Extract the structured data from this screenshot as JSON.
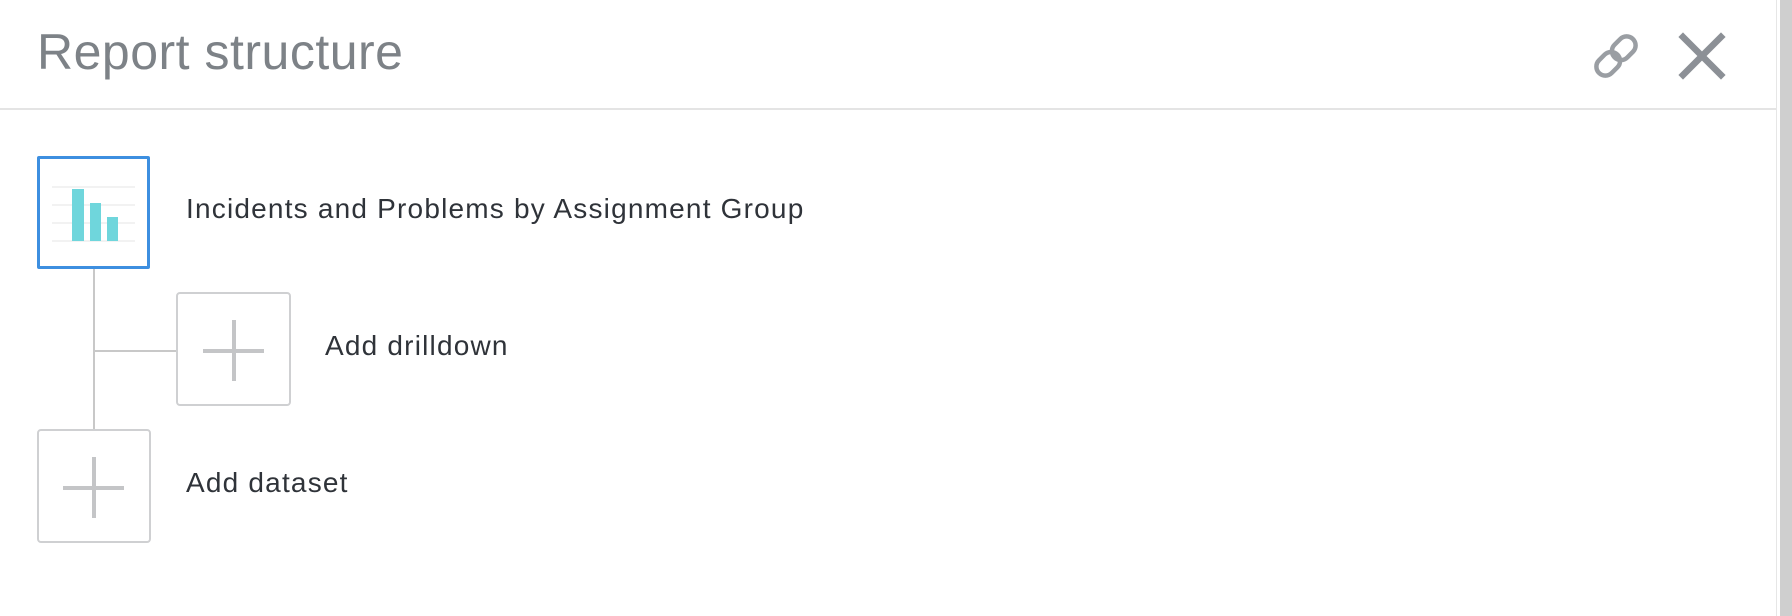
{
  "header": {
    "title": "Report structure",
    "link_icon": "link-icon",
    "close_icon": "close-icon"
  },
  "tree": {
    "dataset": {
      "label": "Incidents and Problems by Assignment Group",
      "icon": "bar-chart-icon",
      "selected": true
    },
    "add_drilldown": {
      "label": "Add drilldown",
      "icon": "plus-icon"
    },
    "add_dataset": {
      "label": "Add dataset",
      "icon": "plus-icon"
    }
  },
  "colors": {
    "accent": "#3d8fe0",
    "chart_bars": "#6fd6dc",
    "title_text": "#7d8287",
    "label_text": "#2f3339",
    "icon_gray": "#9a9ea3",
    "plus_gray": "#c4c5c7"
  }
}
